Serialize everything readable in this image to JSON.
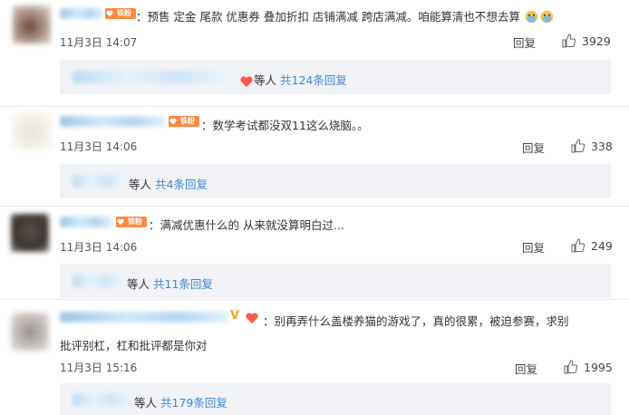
{
  "comments": [
    {
      "text": "：预售 定金 尾款 优惠券 叠加折扣 店铺满减 跨店满减。咱能算清也不想去算",
      "date": "11月3日 14:07",
      "reply_label": "回复",
      "likes": "3929",
      "sub_suffix": "等人",
      "sub_link": "共124条回复",
      "fan_badge": "铁粉",
      "emoji_trailing": [
        "doge-icon",
        "doge-icon"
      ]
    },
    {
      "text": "：数学考试都没双11这么烧脑。。",
      "date": "11月3日 14:06",
      "reply_label": "回复",
      "likes": "338",
      "sub_suffix": "等人",
      "sub_link": "共4条回复",
      "fan_badge": "铁粉"
    },
    {
      "text": "：满减优惠什么的 从来就没算明白过...",
      "date": "11月3日 14:06",
      "reply_label": "回复",
      "likes": "249",
      "sub_suffix": "等人",
      "sub_link": "共11条回复",
      "fan_badge": "铁粉"
    },
    {
      "text_line1": "：别再弄什么盖楼养猫的游戏了，真的很累，被迫参赛，求别",
      "text_line2": "批评别杠，杠和批评都是你对",
      "date": "11月3日 15:16",
      "reply_label": "回复",
      "likes": "1995",
      "sub_suffix": "等人",
      "sub_link": "共179条回复",
      "vip_mark": "V"
    }
  ],
  "colors": {
    "link": "#3e8ad6",
    "badge": "#ff8a3d",
    "sub_bg": "#f1f2f5",
    "text": "#333333"
  }
}
